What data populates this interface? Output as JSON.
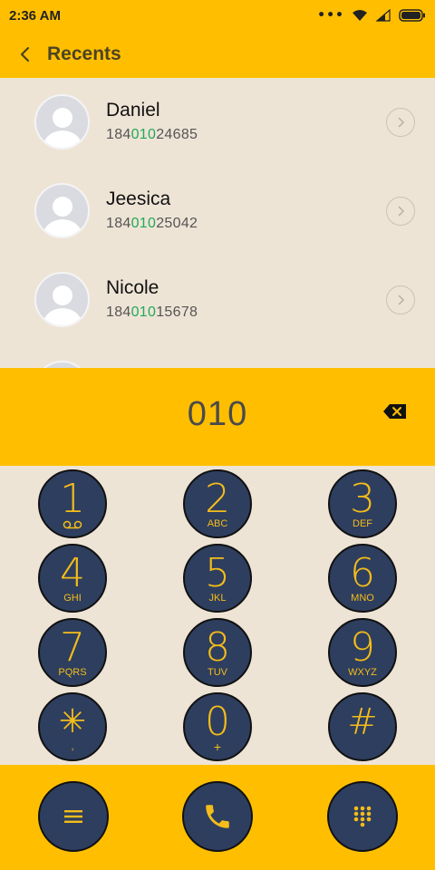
{
  "status_bar": {
    "time": "2:36 AM"
  },
  "header": {
    "title": "Recents"
  },
  "contacts": [
    {
      "name": "Daniel",
      "number_prefix": "184",
      "number_match": "010",
      "number_suffix": "24685"
    },
    {
      "name": "Jeesica",
      "number_prefix": "184",
      "number_match": "010",
      "number_suffix": "25042"
    },
    {
      "name": "Nicole",
      "number_prefix": "184",
      "number_match": "010",
      "number_suffix": "15678"
    }
  ],
  "dialer": {
    "input": "010"
  },
  "keypad": [
    {
      "digit": "1",
      "letters": "",
      "icon": "voicemail-icon"
    },
    {
      "digit": "2",
      "letters": "ABC"
    },
    {
      "digit": "3",
      "letters": "DEF"
    },
    {
      "digit": "4",
      "letters": "GHI"
    },
    {
      "digit": "5",
      "letters": "JKL"
    },
    {
      "digit": "6",
      "letters": "MNO"
    },
    {
      "digit": "7",
      "letters": "PQRS"
    },
    {
      "digit": "8",
      "letters": "TUV"
    },
    {
      "digit": "9",
      "letters": "WXYZ"
    },
    {
      "digit": "✳",
      "letters": ","
    },
    {
      "digit": "0",
      "letters": "+"
    },
    {
      "digit": "#",
      "letters": ""
    }
  ],
  "bottom_bar": {
    "menu_icon": "menu-icon",
    "call_icon": "phone-icon",
    "dialpad_icon": "dialpad-icon"
  },
  "colors": {
    "accent": "#ffbf00",
    "key_bg": "#2e3e5e",
    "key_fg": "#f5bd1a",
    "match": "#22a85a",
    "panel_bg": "#eee4d6"
  }
}
